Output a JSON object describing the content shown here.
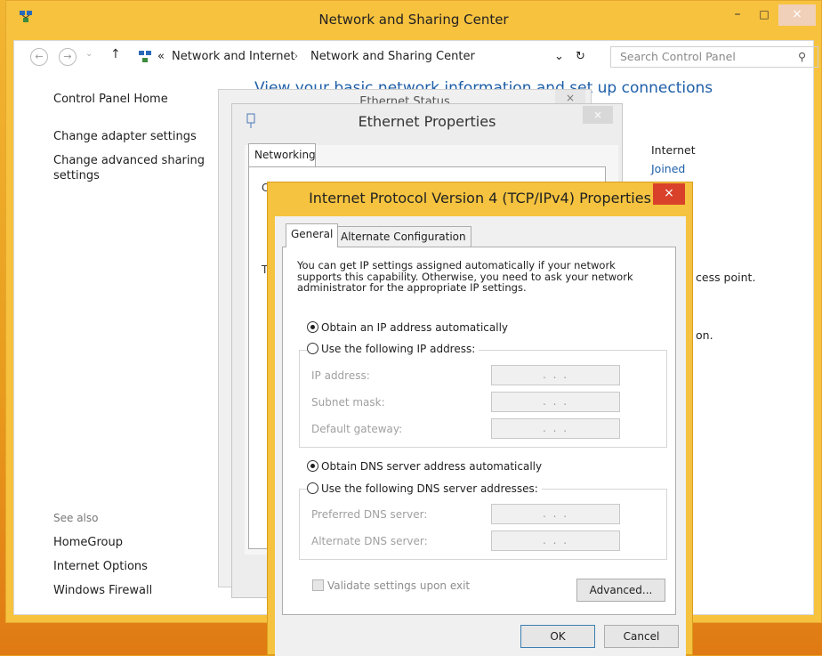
{
  "main_window": {
    "title": "Network and Sharing Center",
    "minimize_glyph": "–",
    "maximize_glyph": "□",
    "close_glyph": "×",
    "address": {
      "separator": "«",
      "crumb1": "Network and Internet",
      "arrow": "›",
      "crumb2": "Network and Sharing Center",
      "dropdown_glyph": "⌄",
      "refresh_glyph": "↻"
    },
    "search": {
      "placeholder": "Search Control Panel",
      "icon_glyph": "⚲"
    },
    "nav": {
      "back": "←",
      "forward": "→",
      "recent": "⌄",
      "up": "↑"
    },
    "left_pane": {
      "control_panel_home": "Control Panel Home",
      "change_adapter": "Change adapter settings",
      "change_advanced_1": "Change advanced sharing",
      "change_advanced_2": "settings",
      "see_also": "See also",
      "homegroup": "HomeGroup",
      "internet_options": "Internet Options",
      "windows_firewall": "Windows Firewall"
    },
    "heading": "View your basic network information and set up connections",
    "right": {
      "internet_label": "Internet",
      "joined": "Joined",
      "access_point_frag": "cess point.",
      "on_frag": "on."
    }
  },
  "ethernet_status": {
    "title": "Ethernet Status",
    "close_glyph": "×"
  },
  "ethernet_properties": {
    "title": "Ethernet Properties",
    "close_glyph": "×",
    "tab_networking": "Networking",
    "frag_c": "C",
    "frag_t": "T"
  },
  "ipv4": {
    "title": "Internet Protocol Version 4 (TCP/IPv4) Properties",
    "close_glyph": "×",
    "tabs": {
      "general": "General",
      "alternate": "Alternate Configuration"
    },
    "description": "You can get IP settings assigned automatically if your network supports this capability. Otherwise, you need to ask your network administrator for the appropriate IP settings.",
    "obtain_ip_auto": "Obtain an IP address automatically",
    "use_following_ip": "Use the following IP address:",
    "ip_address_label": "IP address:",
    "subnet_mask_label": "Subnet mask:",
    "default_gateway_label": "Default gateway:",
    "obtain_dns_auto": "Obtain DNS server address automatically",
    "use_following_dns": "Use the following DNS server addresses:",
    "preferred_dns_label": "Preferred DNS server:",
    "alternate_dns_label": "Alternate DNS server:",
    "empty_ip": ". . .",
    "validate_label": "Validate settings upon exit",
    "advanced_button": "Advanced...",
    "ok_button": "OK",
    "cancel_button": "Cancel",
    "ip_mode": "automatic",
    "dns_mode": "automatic",
    "validate_checked": false
  }
}
